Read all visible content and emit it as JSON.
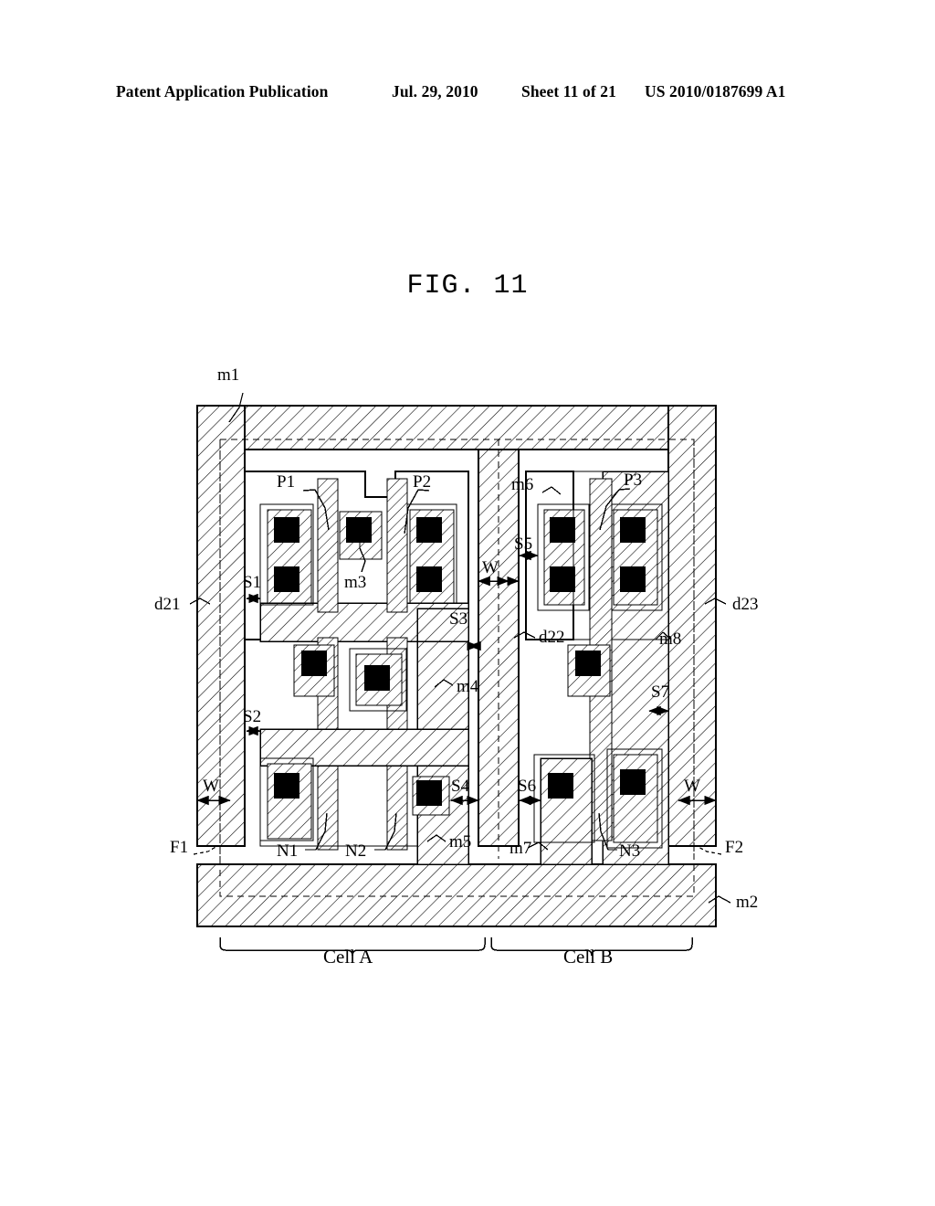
{
  "header": {
    "publication": "Patent Application Publication",
    "date": "Jul. 29, 2010",
    "sheet": "Sheet 11 of 21",
    "number": "US 2010/0187699 A1"
  },
  "figure": {
    "title": "FIG. 11",
    "caption_left": "Cell A",
    "caption_right": "Cell B"
  },
  "labels": {
    "m1": "m1",
    "m2": "m2",
    "m3": "m3",
    "m4": "m4",
    "m5": "m5",
    "m6": "m6",
    "m7": "m7",
    "m8": "m8",
    "d21": "d21",
    "d22": "d22",
    "d23": "d23",
    "P1": "P1",
    "P2": "P2",
    "P3": "P3",
    "N1": "N1",
    "N2": "N2",
    "N3": "N3",
    "S1": "S1",
    "S2": "S2",
    "S3": "S3",
    "S4": "S4",
    "S5": "S5",
    "S6": "S6",
    "S7": "S7",
    "W1": "W",
    "W2": "W",
    "W3": "W",
    "W4": "W",
    "F1": "F1",
    "F2": "F2"
  },
  "colors": {
    "line": "#000000",
    "fill_white": "#ffffff",
    "contact_black": "#000000",
    "hatch": "#000000"
  }
}
